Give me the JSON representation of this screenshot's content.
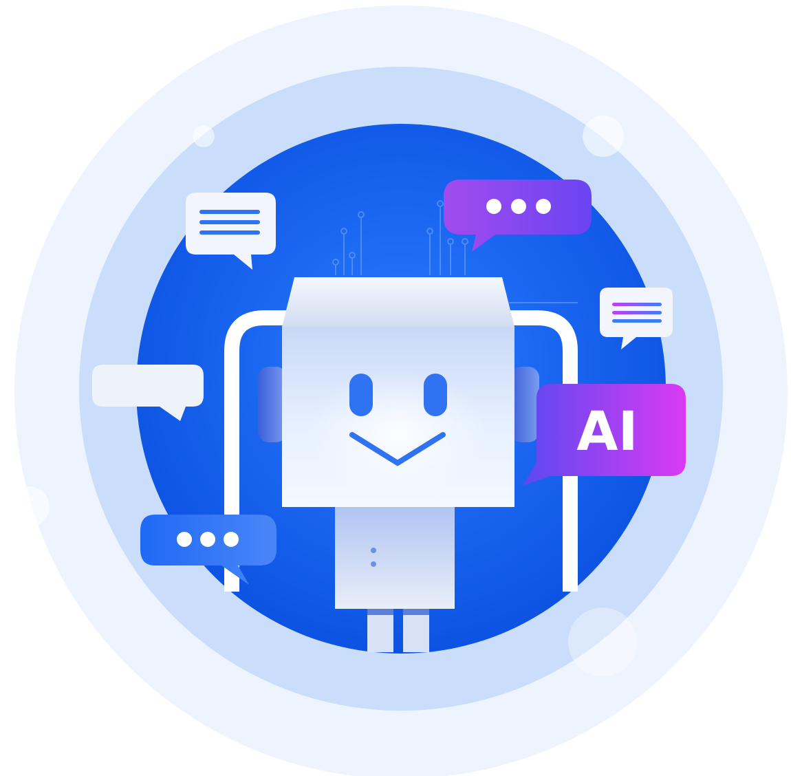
{
  "illustration": {
    "badge_text": "AI",
    "colors": {
      "outer_ring": "#EAF2FE",
      "mid_ring": "#C9DDFB",
      "core": "#0F63F6",
      "core_dark": "#0A4FE0",
      "robot_head": "#DDE8FB",
      "robot_eye": "#2F73F2",
      "badge_start": "#6A4CF5",
      "badge_end": "#D23BF0",
      "bubble_purple": "#8B47F0",
      "bubble_blue": "#2F73F2",
      "bubble_white": "#F2F5FB"
    },
    "icons": [
      "chat-bubble-lines-icon",
      "chat-bubble-dots-icon",
      "chat-bubble-empty-icon",
      "ai-badge-icon",
      "robot-icon"
    ]
  }
}
